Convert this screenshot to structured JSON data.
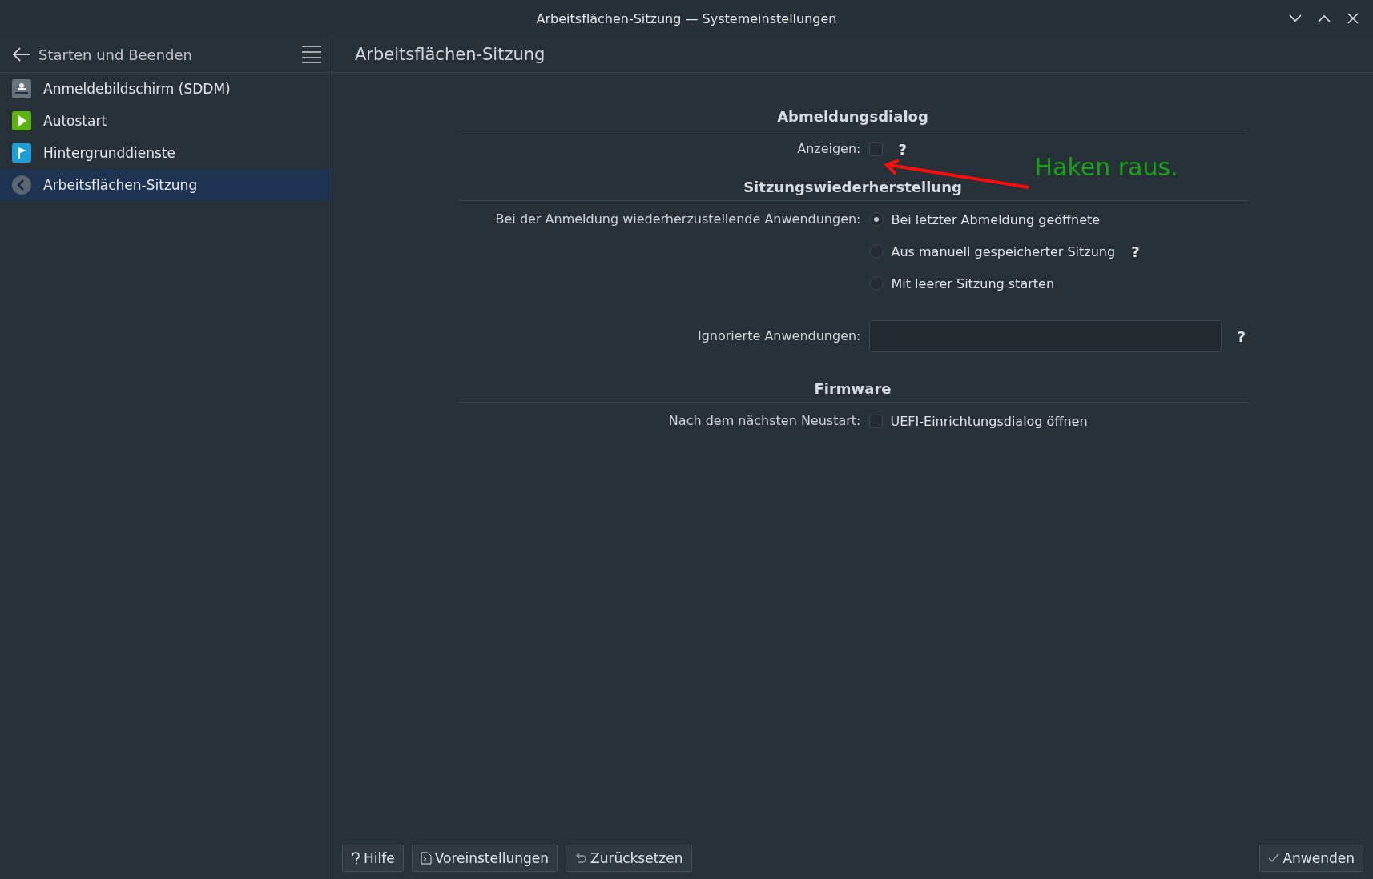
{
  "window": {
    "title": "Arbeitsflächen-Sitzung — Systemeinstellungen"
  },
  "sidebar": {
    "header": "Starten und Beenden",
    "items": [
      {
        "label": "Anmeldebildschirm (SDDM)",
        "kind": "login",
        "selected": false
      },
      {
        "label": "Autostart",
        "kind": "play",
        "selected": false
      },
      {
        "label": "Hintergrunddienste",
        "kind": "flag",
        "selected": false
      },
      {
        "label": "Arbeitsflächen-Sitzung",
        "kind": "back",
        "selected": true
      }
    ]
  },
  "page": {
    "title": "Arbeitsflächen-Sitzung",
    "sections": [
      {
        "heading": "Abmeldungsdialog",
        "rows": [
          {
            "kind": "checkbox",
            "label": "Anzeigen:",
            "checked": false,
            "help": "?"
          }
        ]
      },
      {
        "heading": "Sitzungswiederherstellung",
        "rows": [
          {
            "kind": "radio",
            "label": "Bei der Anmeldung wiederherzustellende Anwendungen:",
            "options": [
              {
                "label": "Bei letzter Abmeldung geöffnete",
                "selected": true
              },
              {
                "label": "Aus manuell gespeicherter Sitzung",
                "selected": false,
                "help": "?"
              },
              {
                "label": "Mit leerer Sitzung starten",
                "selected": false
              }
            ]
          },
          {
            "kind": "text",
            "label": "Ignorierte Anwendungen:",
            "help": "?"
          }
        ]
      },
      {
        "heading": "Firmware",
        "rows": [
          {
            "kind": "checkbox",
            "label": "Nach dem nächsten Neustart:",
            "option": "UEFI-Einrichtungsdialog öffnen",
            "checked": false
          }
        ]
      }
    ]
  },
  "annotation": {
    "text": "Haken raus."
  },
  "buttons": [
    {
      "label": "Hilfe",
      "kind": "help"
    },
    {
      "label": "Voreinstellungen",
      "kind": "defaults"
    },
    {
      "label": "Zurücksetzen",
      "kind": "reset"
    }
  ],
  "apply_button": {
    "label": "Anwenden"
  }
}
